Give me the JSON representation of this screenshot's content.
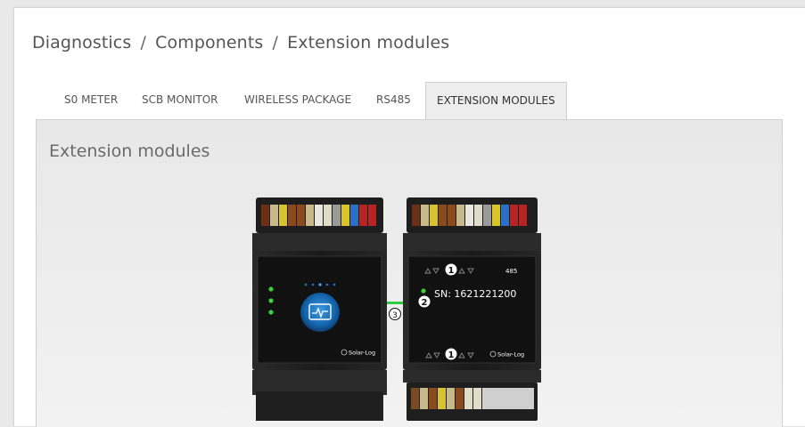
{
  "breadcrumb": {
    "items": [
      "Diagnostics",
      "Components",
      "Extension modules"
    ],
    "separator": "/"
  },
  "tabs": [
    {
      "label": "S0 METER",
      "active": false
    },
    {
      "label": "SCB MONITOR",
      "active": false
    },
    {
      "label": "WIRELESS PACKAGE",
      "active": false
    },
    {
      "label": "RS485",
      "active": false
    },
    {
      "label": "EXTENSION MODULES",
      "active": true
    }
  ],
  "panel": {
    "title": "Extension modules"
  },
  "device": {
    "main_brand": "Solar-Log",
    "extension": {
      "bus_label": "485",
      "serial_label": "SN: 1621221200",
      "brand": "Solar-Log"
    },
    "callouts": {
      "top": "1",
      "serial": "2",
      "connector": "3",
      "bottom": "1"
    }
  },
  "colors": {
    "status_led": "#3ccf3c",
    "logo_blue": "#1b6fb8",
    "housing": "#1c1c1c"
  }
}
